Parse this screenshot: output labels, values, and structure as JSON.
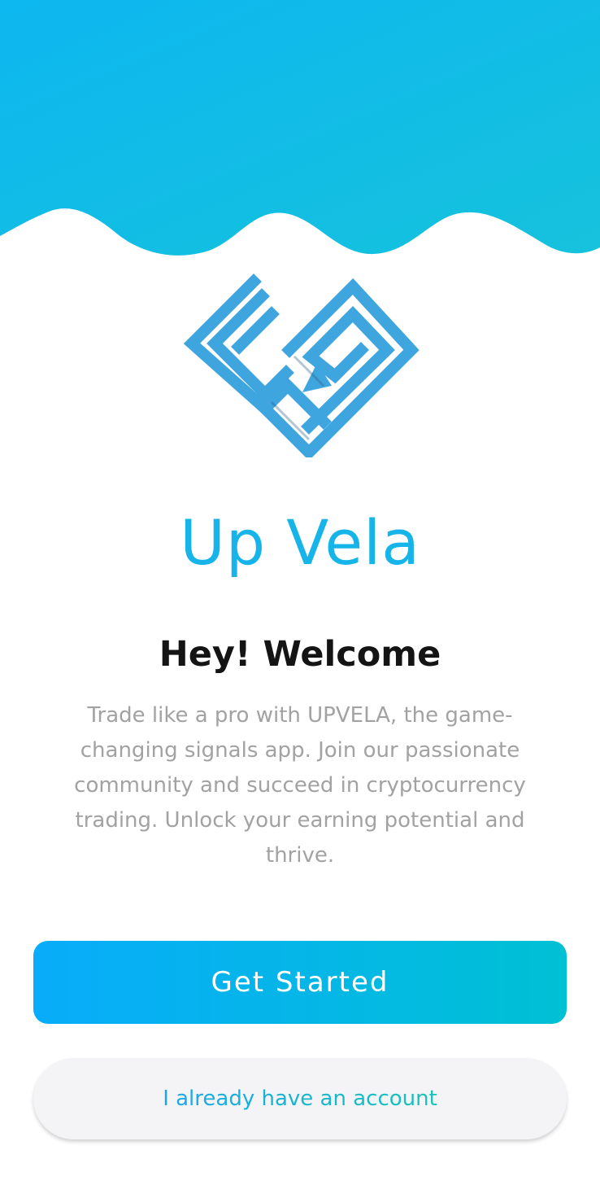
{
  "brand": {
    "name": "Up Vela",
    "logo_icon": "upvela-maze-heart-logo",
    "primary_color": "#16b4e8",
    "logo_color": "#3fa5df",
    "gradient_start": "#08acfa",
    "gradient_end": "#00c0d4"
  },
  "welcome": {
    "title": "Hey! Welcome",
    "description": "Trade like a pro with UPVELA, the game-changing signals app. Join our passionate community and succeed in cryptocurrency trading. Unlock your earning potential and thrive."
  },
  "actions": {
    "get_started_label": "Get Started",
    "login_label": "I already have an account"
  }
}
